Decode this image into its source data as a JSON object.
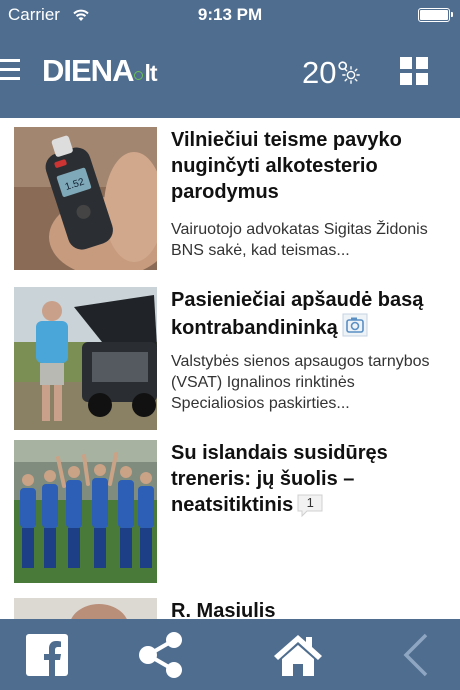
{
  "status_bar": {
    "carrier": "Carrier",
    "time": "9:13 PM"
  },
  "header": {
    "logo_main": "DIENA",
    "logo_tld": "lt",
    "temperature": "20°",
    "menu_icon": "hamburger-menu-icon",
    "weather_icon": "sun-icon",
    "grid_icon": "grid-icon"
  },
  "articles": [
    {
      "title": "Vilniečiui teisme pavyko nuginčyti alkotesterio parodymus",
      "lead": "Vairuotojo advokatas Sigitas Židonis BNS sakė, kad teismas..."
    },
    {
      "title": "Pasieniečiai apšaudė basą kontrabandininką",
      "lead": "Valstybės sienos apsaugos tarnybos (VSAT) Ignalinos rinktinės Specialiosios paskirties...",
      "badge_icon": "camera-icon"
    },
    {
      "title": "Su islandais susidūręs treneris: jų šuolis – neatsitiktinis",
      "comment_count": "1",
      "badge_icon": "comment-icon"
    },
    {
      "title": "R. Masiulis"
    }
  ],
  "tab_bar": {
    "items": [
      "facebook-icon",
      "share-icon",
      "home-icon",
      "back-arrow-icon"
    ]
  },
  "colors": {
    "header_bg": "#4f6d8f",
    "tab_bar_bg": "#4f6d8f",
    "logo_dot": "#6ac055"
  }
}
